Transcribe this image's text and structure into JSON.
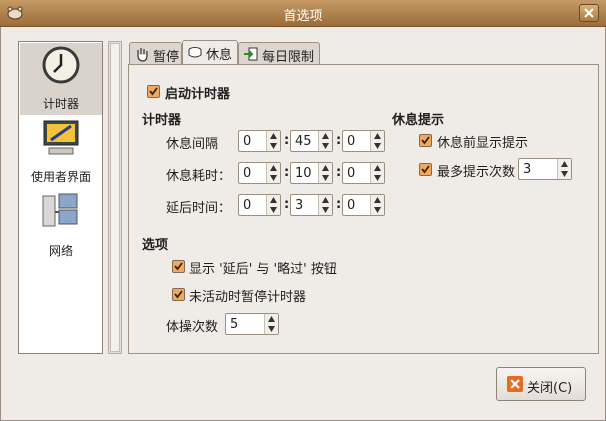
{
  "window": {
    "title": "首选项"
  },
  "sidebar": {
    "items": [
      {
        "label": "计时器",
        "icon": "clock-icon",
        "selected": true
      },
      {
        "label": "使用者界面",
        "icon": "monitor-icon",
        "selected": false
      },
      {
        "label": "网络",
        "icon": "network-icon",
        "selected": false
      }
    ]
  },
  "tabs": [
    {
      "label": "暂停",
      "icon": "hand-icon",
      "active": false
    },
    {
      "label": "休息",
      "icon": "cup-icon",
      "active": true
    },
    {
      "label": "每日限制",
      "icon": "exit-icon",
      "active": false
    }
  ],
  "panel": {
    "enable_timer": {
      "label": "启动计时器",
      "checked": true
    },
    "timer_section": {
      "title": "计时器",
      "rows": [
        {
          "label": "休息间隔",
          "h": "0",
          "m": "45",
          "s": "0"
        },
        {
          "label": "休息耗时：",
          "h": "0",
          "m": "10",
          "s": "0"
        },
        {
          "label": "延后时间：",
          "h": "0",
          "m": "3",
          "s": "0"
        }
      ]
    },
    "hint_section": {
      "title": "休息提示",
      "show_hint": {
        "label": "休息前显示提示",
        "checked": true
      },
      "max_hints": {
        "label": "最多提示次数",
        "checked": true,
        "value": "3"
      }
    },
    "options_section": {
      "title": "选项",
      "show_buttons": {
        "label": "显示 '延后' 与 '略过' 按钮",
        "checked": true
      },
      "pause_inactive": {
        "label": "未活动时暂停计时器",
        "checked": true
      },
      "exercises": {
        "label": "体操次数",
        "value": "5"
      }
    }
  },
  "footer": {
    "close_label": "关闭(C)"
  },
  "colors": {
    "titlebar": "#b0824c",
    "checkbox": "#f4a85d",
    "close": "#e86a20"
  }
}
